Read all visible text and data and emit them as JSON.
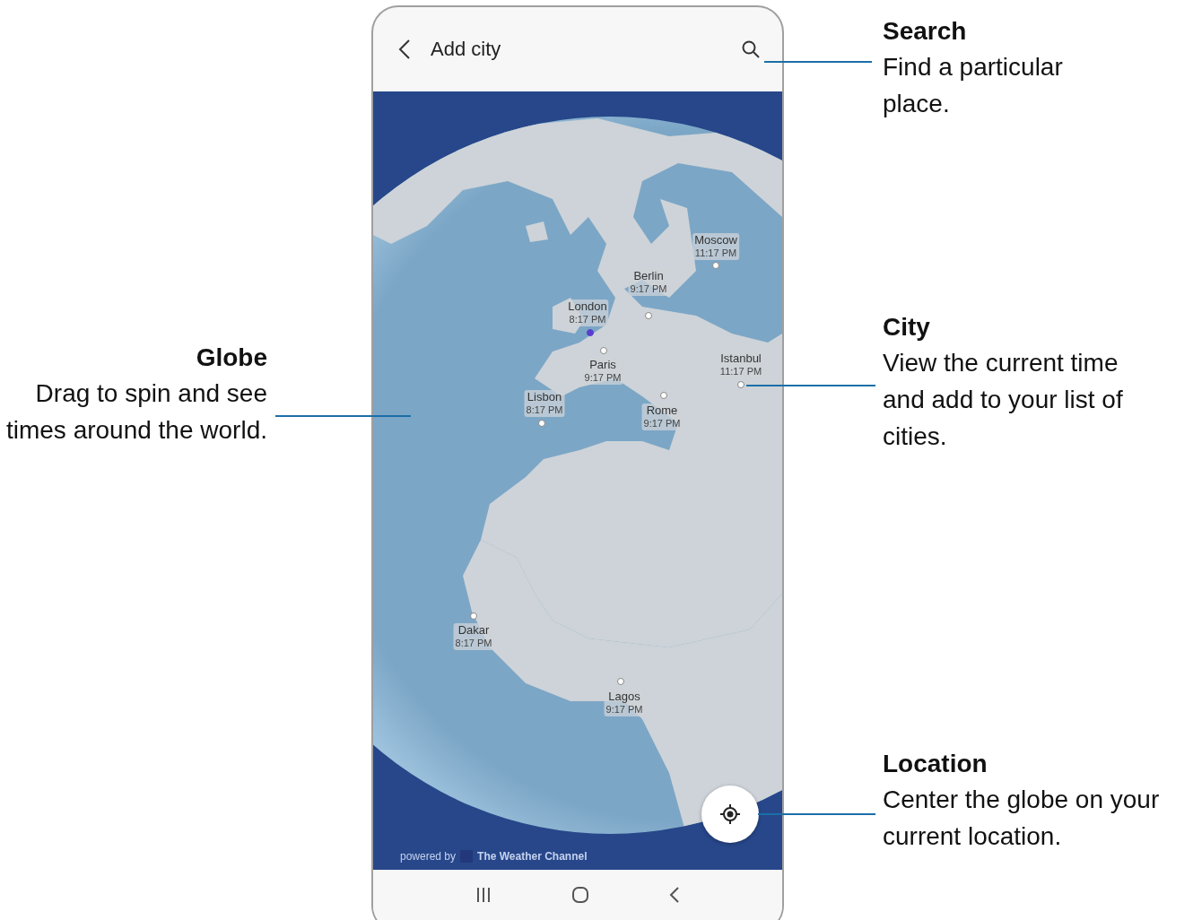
{
  "app_bar": {
    "title": "Add city"
  },
  "cities": [
    {
      "name": "Moscow",
      "time": "11:17 PM",
      "current": false
    },
    {
      "name": "Berlin",
      "time": "9:17 PM",
      "current": false
    },
    {
      "name": "London",
      "time": "8:17 PM",
      "current": true
    },
    {
      "name": "Paris",
      "time": "9:17 PM",
      "current": false
    },
    {
      "name": "Istanbul",
      "time": "11:17 PM",
      "current": false
    },
    {
      "name": "Lisbon",
      "time": "8:17 PM",
      "current": false
    },
    {
      "name": "Rome",
      "time": "9:17 PM",
      "current": false
    },
    {
      "name": "Dakar",
      "time": "8:17 PM",
      "current": false
    },
    {
      "name": "Lagos",
      "time": "9:17 PM",
      "current": false
    }
  ],
  "attribution": {
    "prefix": "powered by",
    "brand": "The Weather Channel"
  },
  "callouts": [
    {
      "title": "Search",
      "text": "Find a particular place."
    },
    {
      "title": "Globe",
      "text": "Drag to spin and see times around the world."
    },
    {
      "title": "City",
      "text": "View the current time and add to your list of cities."
    },
    {
      "title": "Location",
      "text": "Center the globe on your current location."
    }
  ]
}
